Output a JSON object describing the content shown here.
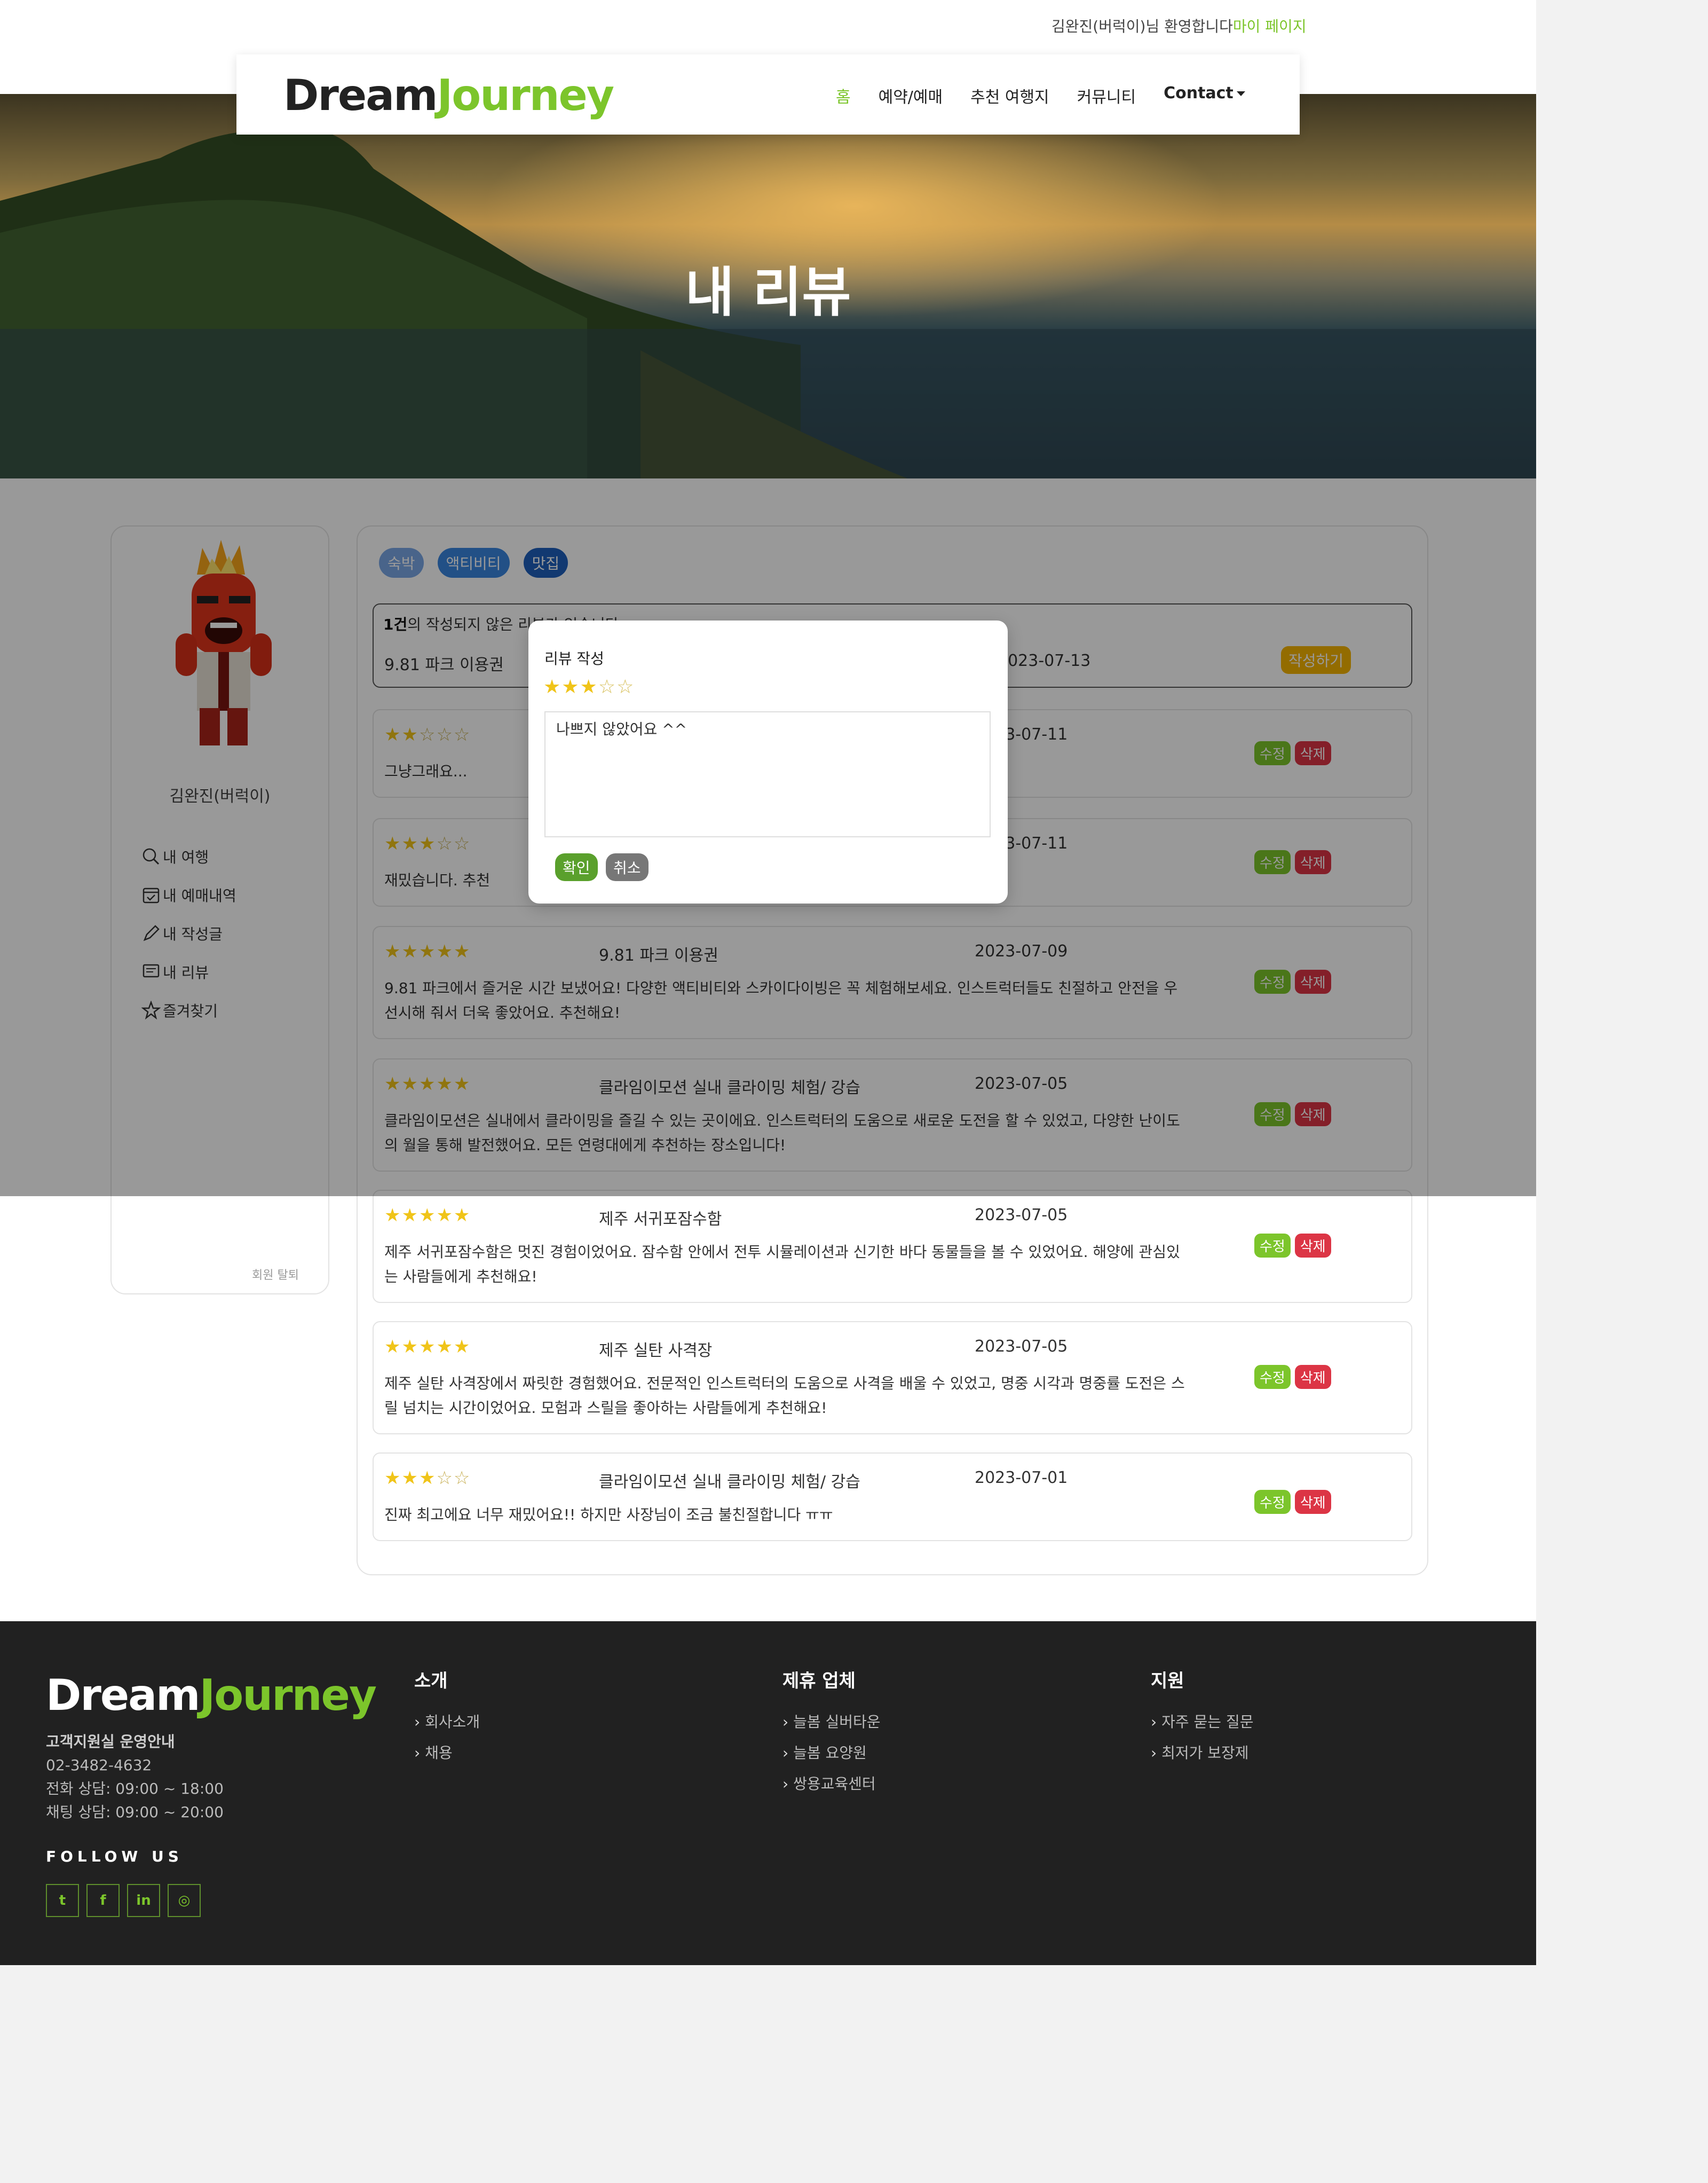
{
  "topbar": {
    "welcome": "김완진(버럭이)님 환영합니다",
    "mypage": "마이 페이지"
  },
  "logo": {
    "part1": "Dream",
    "part2": "Journey"
  },
  "nav": {
    "home": "홈",
    "booking": "예약/예매",
    "recommend": "추천 여행지",
    "community": "커뮤니티",
    "contact": "Contact"
  },
  "hero": {
    "title": "내 리뷰"
  },
  "sidebar": {
    "name": "김완진(버럭이)",
    "items": [
      {
        "label": "내 여행",
        "icon": "travel-search-icon"
      },
      {
        "label": "내 예매내역",
        "icon": "calendar-check-icon"
      },
      {
        "label": "내 작성글",
        "icon": "pencil-icon"
      },
      {
        "label": "내 리뷰",
        "icon": "review-icon"
      },
      {
        "label": "즐겨찾기",
        "icon": "star-icon"
      }
    ],
    "withdraw": "회원 탈퇴"
  },
  "tabs": [
    "숙박",
    "액티비티",
    "맛집"
  ],
  "pending": {
    "count": "1건",
    "message": "의 작성되지 않은 리뷰가 있습니다",
    "place": "9.81 파크 이용권",
    "date": "2023-07-13",
    "write_label": "작성하기"
  },
  "buttons": {
    "edit": "수정",
    "delete": "삭제"
  },
  "reviews": [
    {
      "rating": 2,
      "place": "",
      "date": "2023-07-11",
      "text": "그냥그래요..."
    },
    {
      "rating": 3,
      "place": "",
      "date": "2023-07-11",
      "text": "재밌습니다. 추천"
    },
    {
      "rating": 5,
      "place": "9.81 파크 이용권",
      "date": "2023-07-09",
      "text": "9.81 파크에서 즐거운 시간 보냈어요! 다양한 액티비티와 스카이다이빙은 꼭 체험해보세요. 인스트럭터들도 친절하고 안전을 우선시해 줘서 더욱 좋았어요. 추천해요!"
    },
    {
      "rating": 5,
      "place": "클라임이모션 실내 클라이밍 체험/ 강습",
      "date": "2023-07-05",
      "text": "클라임이모션은 실내에서 클라이밍을 즐길 수 있는 곳이에요. 인스트럭터의 도움으로 새로운 도전을 할 수 있었고, 다양한 난이도의 월을 통해 발전했어요. 모든 연령대에게 추천하는 장소입니다!"
    },
    {
      "rating": 5,
      "place": "제주 서귀포잠수함",
      "date": "2023-07-05",
      "text": "제주 서귀포잠수함은 멋진 경험이었어요. 잠수함 안에서 전투 시뮬레이션과 신기한 바다 동물들을 볼 수 있었어요. 해양에 관심있는 사람들에게 추천해요!"
    },
    {
      "rating": 5,
      "place": "제주 실탄 사격장",
      "date": "2023-07-05",
      "text": "제주 실탄 사격장에서 짜릿한 경험했어요. 전문적인 인스트럭터의 도움으로 사격을 배울 수 있었고, 명중 시각과 명중률 도전은 스릴 넘치는 시간이었어요. 모험과 스릴을 좋아하는 사람들에게 추천해요!"
    },
    {
      "rating": 3,
      "place": "클라임이모션 실내 클라이밍 체험/ 강습",
      "date": "2023-07-01",
      "text": "진짜 최고에요 너무 재밌어요!! 하지만 사장님이 조금 불친절합니다 ㅠㅠ"
    }
  ],
  "modal": {
    "title": "리뷰 작성",
    "rating": 3,
    "text": "나쁘지 않았어요 ^^",
    "confirm": "확인",
    "cancel": "취소"
  },
  "footer": {
    "info_heading": "고객지원실 운영안내",
    "phone": "02-3482-4632",
    "call_hours": "전화 상담: 09:00 ~ 18:00",
    "chat_hours": "채팅 상담: 09:00 ~ 20:00",
    "follow": "FOLLOW US",
    "social": [
      {
        "name": "twitter",
        "glyph": "t"
      },
      {
        "name": "facebook",
        "glyph": "f"
      },
      {
        "name": "linkedin",
        "glyph": "in"
      },
      {
        "name": "instagram",
        "glyph": "◎"
      }
    ],
    "col1": {
      "heading": "소개",
      "links": [
        "회사소개",
        "채용"
      ]
    },
    "col2": {
      "heading": "제휴 업체",
      "links": [
        "늘봄 실버타운",
        "늘봄 요양원",
        "쌍용교육센터"
      ]
    },
    "col3": {
      "heading": "지원",
      "links": [
        "자주 묻는 질문",
        "최저가 보장제"
      ]
    }
  },
  "colors": {
    "brand": "#7cc52b",
    "danger": "#dc3545",
    "footer_bg": "#212121"
  }
}
